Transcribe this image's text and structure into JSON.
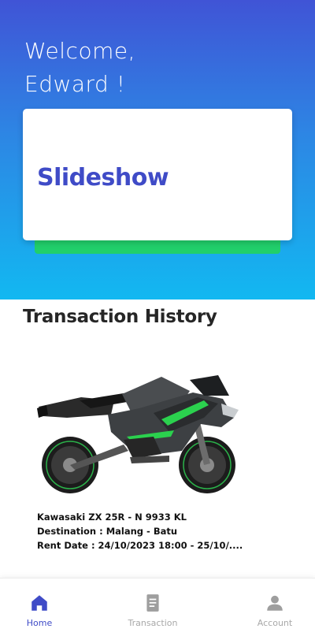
{
  "header": {
    "welcome_line1": "Welcome,",
    "welcome_line2": "Edward !"
  },
  "slideshow": {
    "title": "Slideshow"
  },
  "transactions": {
    "section_title": "Transaction History",
    "items": [
      {
        "vehicle": "Kawasaki ZX 25R  -  N 9933 KL",
        "destination": "Destination : Malang - Batu",
        "rent_date": "Rent Date  : 24/10/2023 18:00 - 25/10/...."
      }
    ]
  },
  "bottom_nav": {
    "items": [
      {
        "label": "Home",
        "icon": "home-icon",
        "active": true
      },
      {
        "label": "Transaction",
        "icon": "document-icon",
        "active": false
      },
      {
        "label": "Account",
        "icon": "user-icon",
        "active": false
      }
    ]
  },
  "colors": {
    "gradient_top": "#4054d6",
    "gradient_bottom": "#12b8f1",
    "accent": "#3f4bc7",
    "green": "#21cf6b"
  }
}
